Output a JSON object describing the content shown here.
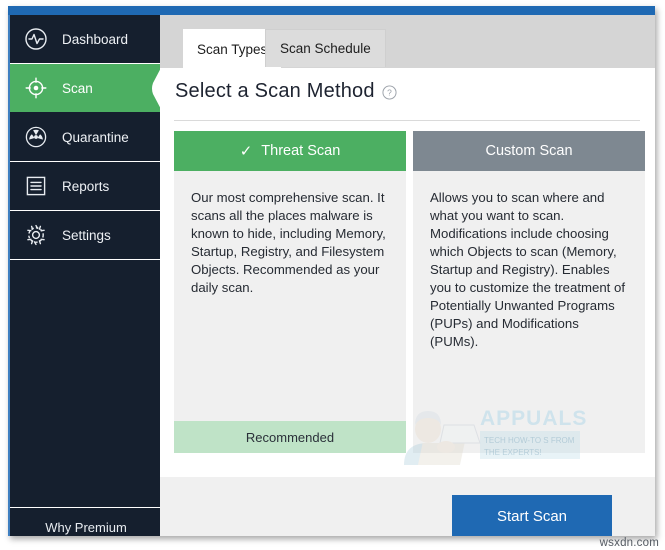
{
  "window": {
    "accent_color": "#1f69b3",
    "sidebar_bg": "#151f2e",
    "active_color": "#4caf62"
  },
  "sidebar": {
    "items": [
      {
        "label": "Dashboard",
        "icon": "pulse-monitor-icon",
        "active": false
      },
      {
        "label": "Scan",
        "icon": "scan-target-icon",
        "active": true
      },
      {
        "label": "Quarantine",
        "icon": "radiation-icon",
        "active": false
      },
      {
        "label": "Reports",
        "icon": "document-lines-icon",
        "active": false
      },
      {
        "label": "Settings",
        "icon": "gear-icon",
        "active": false
      }
    ],
    "footer_label": "Why Premium"
  },
  "tabs": [
    {
      "label": "Scan Types",
      "selected": true
    },
    {
      "label": "Scan Schedule",
      "selected": false
    }
  ],
  "page": {
    "title": "Select a Scan Method",
    "help_icon": "question-mark-circle-icon"
  },
  "cards": [
    {
      "header": "Threat Scan",
      "header_icon": "checkmark-icon",
      "header_color": "#4caf62",
      "body": "Our most comprehensive scan. It scans all the places malware is known to hide, including Memory, Startup, Registry, and Filesystem Objects. Recommended as your daily scan.",
      "footer": "Recommended",
      "footer_color": "#bfe3c7"
    },
    {
      "header": "Custom Scan",
      "header_icon": "",
      "header_color": "#7e8891",
      "body": "Allows you to scan where and what you want to scan. Modifications include choosing which Objects to scan (Memory, Startup and Registry). Enables you to customize the treatment of Potentially Unwanted Programs (PUPs) and Modifications (PUMs).",
      "footer": "",
      "footer_color": ""
    }
  ],
  "footer": {
    "start_scan_label": "Start Scan",
    "start_scan_color": "#1f69b3"
  },
  "watermarks": {
    "brand": "APPUALS",
    "brand_tagline_1": "TECH HOW-TO S FROM",
    "brand_tagline_2": "THE EXPERTS!",
    "site": "wsxdn.com"
  }
}
